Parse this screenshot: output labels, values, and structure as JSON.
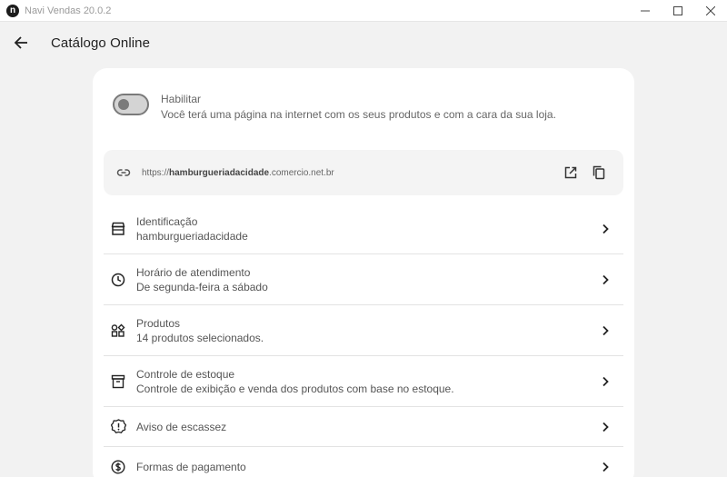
{
  "window": {
    "title": "Navi Vendas 20.0.2",
    "logo_letter": "n"
  },
  "header": {
    "title": "Catálogo Online"
  },
  "enable": {
    "title": "Habilitar",
    "description": "Você terá uma página na internet com os seus produtos e com a cara da sua loja.",
    "enabled": false
  },
  "url": {
    "prefix": "https://",
    "domain": "hamburgueriadacidade",
    "suffix": ".comercio.net.br"
  },
  "items": [
    {
      "icon": "store-icon",
      "title": "Identificação",
      "subtitle": "hamburgueriadacidade"
    },
    {
      "icon": "clock-icon",
      "title": "Horário de atendimento",
      "subtitle": "De segunda-feira a sábado"
    },
    {
      "icon": "products-icon",
      "title": "Produtos",
      "subtitle": "14 produtos selecionados."
    },
    {
      "icon": "archive-icon",
      "title": "Controle de estoque",
      "subtitle": "Controle de exibição e venda dos produtos com base no estoque."
    },
    {
      "icon": "alert-icon",
      "title": "Aviso de escassez",
      "subtitle": ""
    },
    {
      "icon": "dollar-icon",
      "title": "Formas de pagamento",
      "subtitle": ""
    }
  ]
}
